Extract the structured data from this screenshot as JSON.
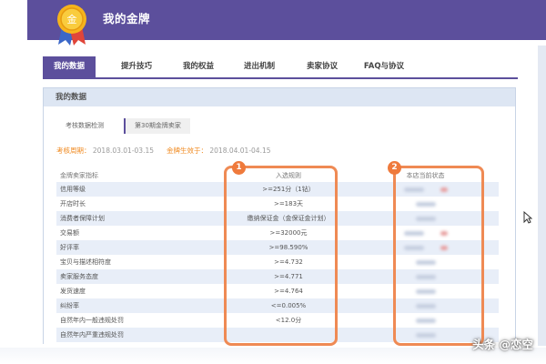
{
  "header": {
    "title": "我的金牌",
    "medal_glyph": "金",
    "bg_color": "#5c4f9c"
  },
  "tabs": [
    {
      "label": "我的数据",
      "active": true
    },
    {
      "label": "提升技巧",
      "active": false
    },
    {
      "label": "我的权益",
      "active": false
    },
    {
      "label": "进出机制",
      "active": false
    },
    {
      "label": "卖家协议",
      "active": false
    },
    {
      "label": "FAQ与协议",
      "active": false
    }
  ],
  "panel": {
    "title": "我的数据",
    "subtabs": [
      "考核数据检测",
      "第30期金牌卖家"
    ],
    "period_label": "考核周期：",
    "period_value": "2018.03.01-03.15",
    "eff_label": "金牌生效于：",
    "eff_value": "2018.04.01-04.15"
  },
  "table": {
    "headers": [
      "金牌卖家指标",
      "入选规则",
      "本店当前状态"
    ],
    "rows": [
      {
        "metric": "信用等级",
        "rule": ">=251分（1钻）"
      },
      {
        "metric": "开店时长",
        "rule": ">=183天"
      },
      {
        "metric": "消费者保障计划",
        "rule": "缴纳保证金（金保证金计划）"
      },
      {
        "metric": "交易额",
        "rule": ">=32000元"
      },
      {
        "metric": "好评率",
        "rule": ">=98.590%"
      },
      {
        "metric": "宝贝与描述相符度",
        "rule": ">=4.732"
      },
      {
        "metric": "卖家服务态度",
        "rule": ">=4.771"
      },
      {
        "metric": "发货速度",
        "rule": ">=4.764"
      },
      {
        "metric": "纠纷率",
        "rule": "<=0.005%"
      },
      {
        "metric": "自然年内一般违规处罚",
        "rule": "<12.0分"
      },
      {
        "metric": "自然年内严重违规处罚",
        "rule": ""
      }
    ]
  },
  "highlights": {
    "badge_1": "1",
    "badge_2": "2",
    "color": "#ef8a54"
  },
  "watermark": "头条 @恋空"
}
